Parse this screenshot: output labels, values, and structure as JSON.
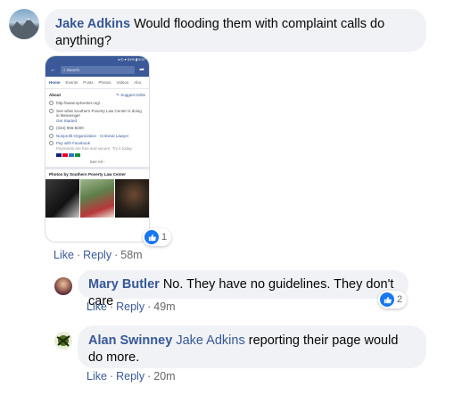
{
  "comments": [
    {
      "author": "Jake Adkins",
      "text": "Would flooding them with complaint calls do anything?",
      "actions": {
        "like": "Like",
        "reply": "Reply",
        "time": "58m"
      },
      "reaction_count": "1",
      "attachment": {
        "status_text": "◂ ◴ ▾ 51% ▮ 5:37",
        "search_placeholder": "Search",
        "tabs": [
          "Home",
          "Events",
          "Posts",
          "Photos",
          "Videos",
          "Abo"
        ],
        "about_title": "About",
        "suggest_edits": "Suggest Edits",
        "website": "http://www.splcenter.org/",
        "messenger_line": "See what Southern Poverty Law Center is doing in Messenger",
        "get_started": "Get Started",
        "phone": "(334) 956-8200",
        "category": "Nonprofit Organization · Criminal Lawyer",
        "pay_title": "Pay with Facebook",
        "pay_sub": "Payments are free and secure. Try it today.",
        "see_all": "See All",
        "photos_title": "Photos by Southern Poverty Law Center"
      }
    },
    {
      "author": "Mary Butler",
      "text": "No. They have no guidelines. They don't care",
      "actions": {
        "like": "Like",
        "reply": "Reply",
        "time": "49m"
      },
      "reaction_count": "2"
    },
    {
      "author": "Alan Swinney",
      "mention": "Jake Adkins",
      "text": "reporting their page would do more.",
      "actions": {
        "like": "Like",
        "reply": "Reply",
        "time": "20m"
      }
    }
  ],
  "colors": {
    "link": "#385898",
    "bubble": "#f0f2f5",
    "like_blue": "#1877f2"
  }
}
